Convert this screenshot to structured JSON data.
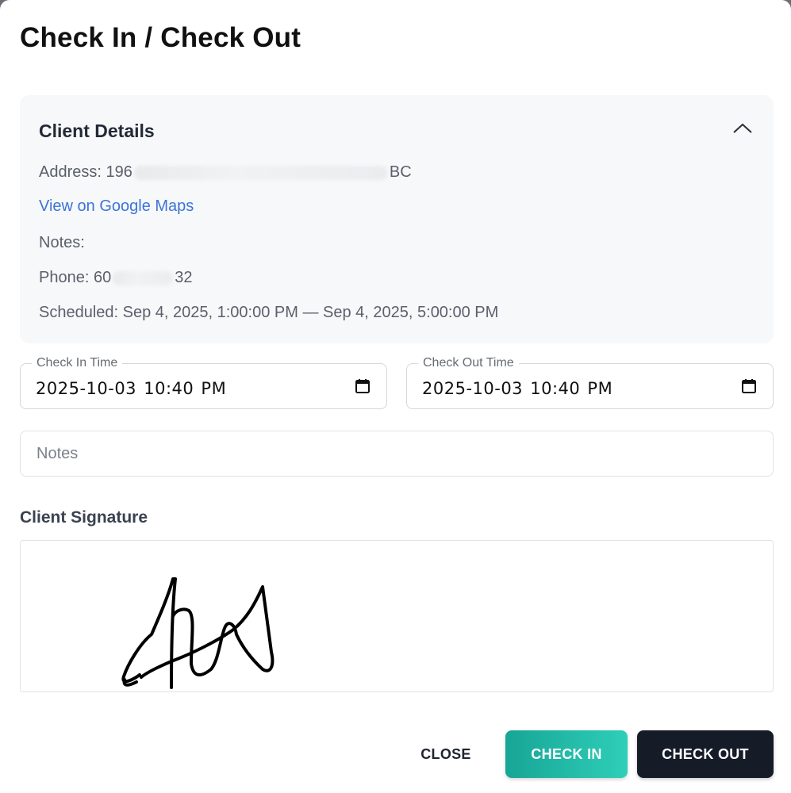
{
  "dialog": {
    "title": "Check In / Check Out"
  },
  "client_details": {
    "heading": "Client Details",
    "address_label": "Address:",
    "address_prefix": "196",
    "address_suffix": "BC",
    "maps_link": "View on Google Maps",
    "notes_label": "Notes:",
    "phone_label": "Phone:",
    "phone_prefix": "60",
    "phone_suffix": "32",
    "scheduled_label": "Scheduled:",
    "scheduled_value": "Sep 4, 2025, 1:00:00 PM — Sep 4, 2025, 5:00:00 PM",
    "toggle_icon": "chevron-up-icon"
  },
  "check_in_time": {
    "label": "Check In Time",
    "value": "2025-10-03 10:40 PM",
    "icon": "calendar-icon"
  },
  "check_out_time": {
    "label": "Check Out Time",
    "value": "2025-10-03 10:40 PM",
    "icon": "calendar-icon"
  },
  "notes": {
    "placeholder": "Notes",
    "value": ""
  },
  "signature": {
    "label": "Client Signature"
  },
  "actions": {
    "close": "CLOSE",
    "check_in": "CHECK IN",
    "check_out": "CHECK OUT"
  },
  "colors": {
    "check_in_gradient_start": "#18a596",
    "check_in_gradient_end": "#2ecfb9",
    "check_out_bg": "#161b28",
    "link": "#3b74d8",
    "details_bg": "#f7f8fa"
  }
}
